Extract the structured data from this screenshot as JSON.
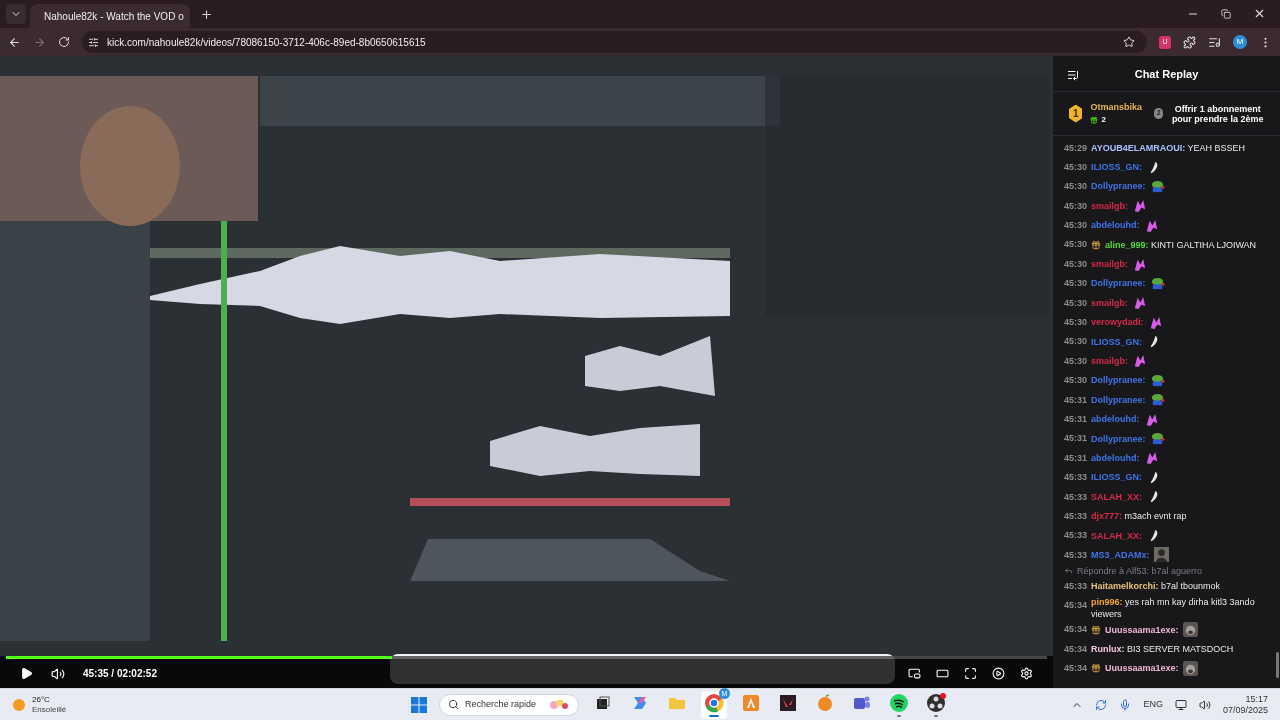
{
  "browser": {
    "tabs": [
      {
        "title": "Nahoule82k - Watch the VOD o",
        "selected": true
      }
    ],
    "url": "kick.com/nahoule82k/videos/78086150-3712-406c-89ed-8b0650615615",
    "forward_disabled": true,
    "extension_badge": "U",
    "profile_initial": "M"
  },
  "player": {
    "paused": true,
    "level": 0.371,
    "time": "45:35 / 02:02:52"
  },
  "chat": {
    "title": "Chat Replay",
    "pinned": {
      "rank": "1",
      "user": "Otmansbika",
      "count": "2",
      "step": "2",
      "text": "Offrir 1 abonnement pour prendre la 2ème"
    },
    "messages": [
      {
        "kind": "text",
        "time": "45:29",
        "user": "AYOUB4ELAMRAOUI:",
        "color": "#a9c1ff",
        "text": "YEAH BSSEH"
      },
      {
        "kind": "feather",
        "time": "45:30",
        "user": "ILIOSS_GN:",
        "color": "#3d74e6"
      },
      {
        "kind": "frog",
        "time": "45:30",
        "user": "Dollypranee:",
        "color": "#3d74e6"
      },
      {
        "kind": "pink",
        "time": "45:30",
        "user": "smailgb:",
        "color": "#d42a45"
      },
      {
        "kind": "pink",
        "time": "45:30",
        "user": "abdelouhd:",
        "color": "#3d74e6"
      },
      {
        "kind": "text",
        "time": "45:30",
        "user": "aline_999:",
        "color": "#57d93b",
        "badge": true,
        "text": "KINTI GALTIHA LJOIWAN"
      },
      {
        "kind": "pink",
        "time": "45:30",
        "user": "smailgb:",
        "color": "#d42a45"
      },
      {
        "kind": "frog",
        "time": "45:30",
        "user": "Dollypranee:",
        "color": "#3d74e6"
      },
      {
        "kind": "pink",
        "time": "45:30",
        "user": "smailgb:",
        "color": "#d42a45"
      },
      {
        "kind": "pink",
        "time": "45:30",
        "user": "verowydadi:",
        "color": "#d42a45"
      },
      {
        "kind": "feather",
        "time": "45:30",
        "user": "ILIOSS_GN:",
        "color": "#3d74e6"
      },
      {
        "kind": "pink",
        "time": "45:30",
        "user": "smailgb:",
        "color": "#d42a45"
      },
      {
        "kind": "frog",
        "time": "45:30",
        "user": "Dollypranee:",
        "color": "#3d74e6"
      },
      {
        "kind": "frog",
        "time": "45:31",
        "user": "Dollypranee:",
        "color": "#3d74e6"
      },
      {
        "kind": "pink",
        "time": "45:31",
        "user": "abdelouhd:",
        "color": "#3d74e6"
      },
      {
        "kind": "frog",
        "time": "45:31",
        "user": "Dollypranee:",
        "color": "#3d74e6"
      },
      {
        "kind": "pink",
        "time": "45:31",
        "user": "abdelouhd:",
        "color": "#3d74e6"
      },
      {
        "kind": "feather",
        "time": "45:33",
        "user": "ILIOSS_GN:",
        "color": "#3d74e6"
      },
      {
        "kind": "feather",
        "time": "45:33",
        "user": "SALAH_XX:",
        "color": "#d42a45"
      },
      {
        "kind": "text",
        "time": "45:33",
        "user": "djx777:",
        "color": "#d42a45",
        "text": "m3ach evnt rap"
      },
      {
        "kind": "feather",
        "time": "45:33",
        "user": "SALAH_XX:",
        "color": "#d42a45"
      },
      {
        "kind": "portrait",
        "time": "45:33",
        "user": "MS3_ADAMx:",
        "color": "#3d74e6"
      },
      {
        "kind": "text",
        "time": "45:33",
        "user": "Haitamelkorchi:",
        "color": "#e9c27a",
        "reply_to": "Répondre à Alf53: b7al aguerro",
        "text": "b7al tbounmok"
      },
      {
        "kind": "text",
        "time": "45:34",
        "user": "pin996:",
        "color": "#f2a43a",
        "text": "yes rah mn kay dirha kitl3 3ando viewers"
      },
      {
        "kind": "ape",
        "time": "45:34",
        "user": "Uuussaama1exe:",
        "color": "#f3b6d8",
        "badge": true
      },
      {
        "kind": "text",
        "time": "45:34",
        "user": "Runlux:",
        "color": "#f5c9dc",
        "text": "BI3 SERVER MATSDOCH"
      },
      {
        "kind": "ape",
        "time": "45:34",
        "user": "Uuussaama1exe:",
        "color": "#f3b6d8",
        "badge": true
      }
    ]
  },
  "taskbar": {
    "weather": {
      "temp": "26°C",
      "desc": "Ensoleillé"
    },
    "search": {
      "placeholder": "Recherche rapide"
    },
    "apps": [
      {
        "kind": "taskview",
        "selected": false,
        "running": false
      },
      {
        "kind": "copilot",
        "selected": false,
        "running": false
      },
      {
        "kind": "folder",
        "selected": false,
        "running": false
      },
      {
        "kind": "chrome",
        "selected": true,
        "running": true,
        "badge": "M"
      },
      {
        "kind": "orange",
        "selected": false,
        "running": false
      },
      {
        "kind": "valorant",
        "selected": false,
        "running": false
      },
      {
        "kind": "fl",
        "selected": false,
        "running": false
      },
      {
        "kind": "teams",
        "selected": false,
        "running": false
      },
      {
        "kind": "spotify",
        "selected": false,
        "running": true
      },
      {
        "kind": "obs",
        "selected": false,
        "running": true
      }
    ],
    "language": "ENG",
    "time": "15:17",
    "date": "07/09/2025"
  }
}
